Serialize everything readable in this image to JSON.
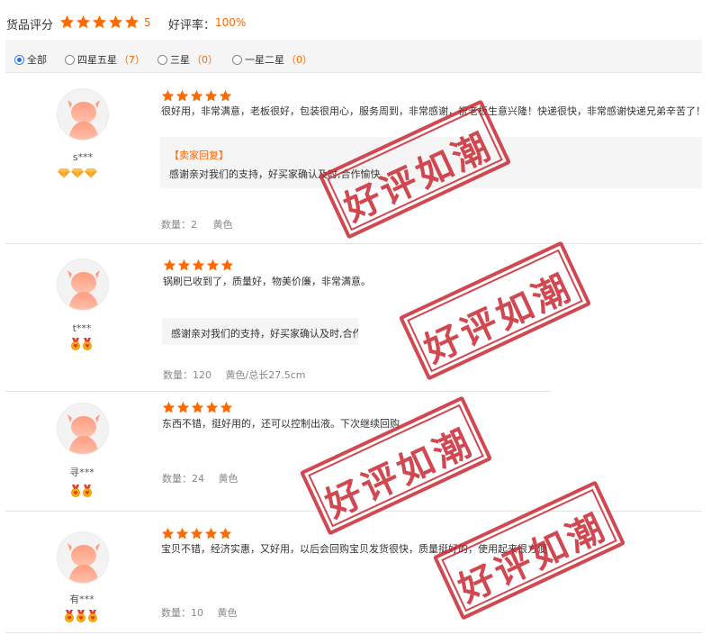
{
  "summary": {
    "label": "货品评分",
    "score": "5",
    "rate_label": "好评率：",
    "rate": "100%"
  },
  "filter": {
    "options": [
      {
        "label": "全部",
        "count": "",
        "checked": true
      },
      {
        "label": "四星五星",
        "count": "（7）",
        "checked": false
      },
      {
        "label": "三星",
        "count": "（0）",
        "checked": false
      },
      {
        "label": "一星二星",
        "count": "（0）",
        "checked": false
      }
    ]
  },
  "reviews": [
    {
      "user": "s***",
      "level_icon": "diamond-icon",
      "level_count": 3,
      "rating": 5,
      "text": "很好用，非常满意，老板很好，包装很用心，服务周到，非常感谢，祝老板生意兴隆！快递很快，非常感谢快递兄弟辛苦了！",
      "reply_title": "【卖家回复】",
      "reply": "感谢亲对我们的支持，好买家确认及时,合作愉快",
      "meta_qty": "数量：2",
      "meta_spec": "黄色"
    },
    {
      "user": "t***",
      "level_icon": "heart-medal-icon",
      "level_count": 2,
      "rating": 5,
      "text": "锅刷已收到了，质量好，物美价廉，非常满意。",
      "reply_title": "",
      "reply": "感谢亲对我们的支持，好买家确认及时,合作愉",
      "meta_qty": "数量：120",
      "meta_spec": "黄色/总长27.5cm"
    },
    {
      "user": "寻***",
      "level_icon": "heart-medal-icon",
      "level_count": 2,
      "rating": 5,
      "text": "东西不错，挺好用的，还可以控制出液。下次继续回购",
      "reply_title": "",
      "reply": "",
      "meta_qty": "数量：24",
      "meta_spec": "黄色"
    },
    {
      "user": "有***",
      "level_icon": "heart-medal-icon",
      "level_count": 3,
      "rating": 5,
      "text": "宝贝不错，经济实惠，又好用，以后会回购宝贝发货很快，质量挺好的，使用起来很方便",
      "reply_title": "",
      "reply": "",
      "meta_qty": "数量：10",
      "meta_spec": "黄色"
    }
  ],
  "stamp_text": "好评如潮",
  "colors": {
    "accent": "#ff6600",
    "star": "#ff6a00",
    "stamp": "#c8212c",
    "radio": "#2a6fd6"
  }
}
